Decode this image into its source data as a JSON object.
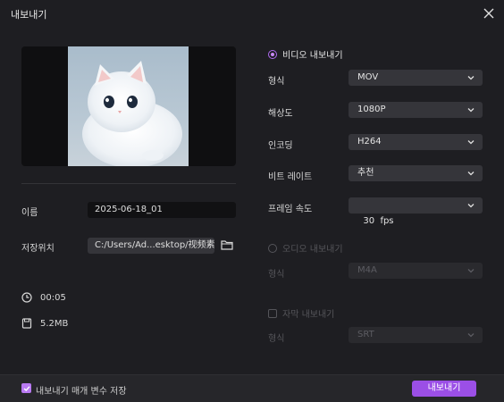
{
  "window": {
    "title": "내보내기"
  },
  "left": {
    "name_label": "이름",
    "name_value": "2025-06-18_01",
    "path_label": "저장위치",
    "path_value": "C:/Users/Ad...esktop/视频素材",
    "duration": "00:05",
    "size": "5.2MB"
  },
  "video": {
    "section_label": "비디오 내보내기",
    "rows": [
      {
        "label": "형식",
        "value": "MOV"
      },
      {
        "label": "해상도",
        "value": "1080P"
      },
      {
        "label": "인코딩",
        "value": "H264"
      },
      {
        "label": "비트 레이트",
        "value": "추천"
      },
      {
        "label": "프레임 속도",
        "value": "30  fps"
      }
    ]
  },
  "audio": {
    "section_label": "오디오 내보내기",
    "format_label": "형식",
    "format_value": "M4A"
  },
  "subtitle": {
    "section_label": "자막 내보내기",
    "format_label": "형식",
    "format_value": "SRT"
  },
  "footer": {
    "save_params_label": "내보내기 매개 변수 저장",
    "export_button": "내보내기"
  },
  "colors": {
    "accent": "#9b4fe6",
    "background": "#1e1e22"
  }
}
